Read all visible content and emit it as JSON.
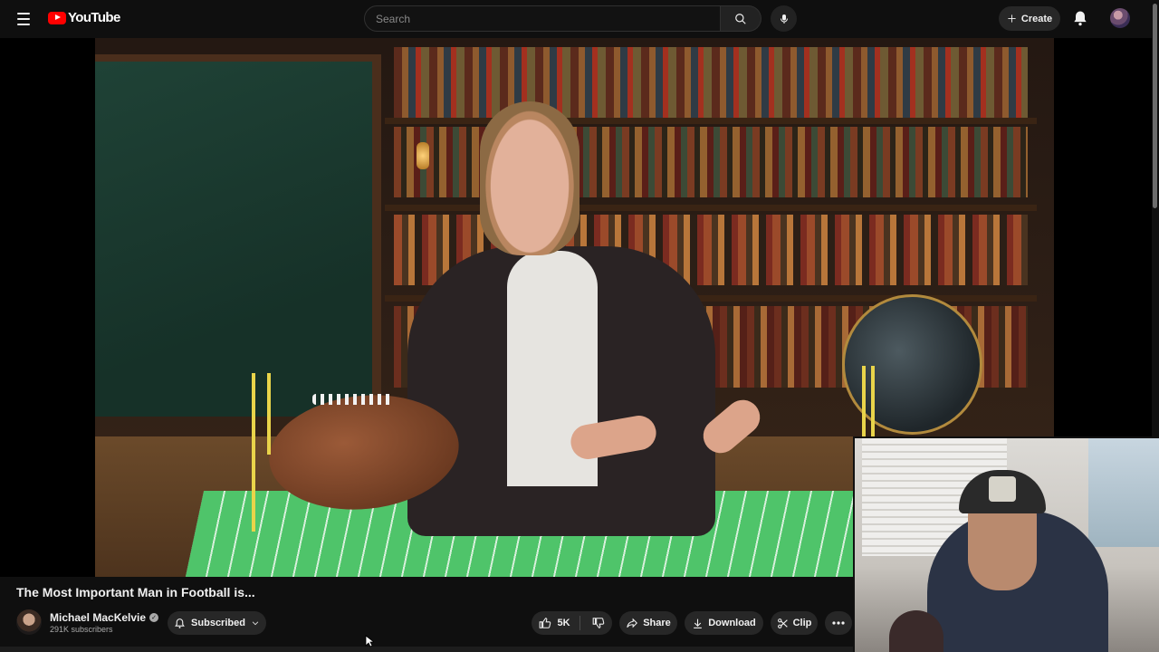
{
  "masthead": {
    "logo_text": "YouTube",
    "search_placeholder": "Search",
    "create_label": "Create"
  },
  "video": {
    "title": "The Most Important Man in Football is...",
    "channel_name": "Michael MacKelvie",
    "subscribers": "291K subscribers",
    "subscribe_state": "Subscribed",
    "likes": "5K",
    "share_label": "Share",
    "download_label": "Download",
    "clip_label": "Clip"
  },
  "colors": {
    "background": "#0f0f0f",
    "pill": "#272727",
    "brand_red": "#ff0000",
    "text": "#f1f1f1",
    "secondary_text": "#aaaaaa"
  },
  "icons": [
    "menu-icon",
    "youtube-logo-icon",
    "search-icon",
    "mic-icon",
    "plus-icon",
    "bell-icon",
    "verified-icon",
    "bell-subscribed-icon",
    "chevron-down-icon",
    "thumbs-up-icon",
    "thumbs-down-icon",
    "share-icon",
    "download-icon",
    "scissors-icon",
    "more-icon",
    "cursor-icon"
  ]
}
